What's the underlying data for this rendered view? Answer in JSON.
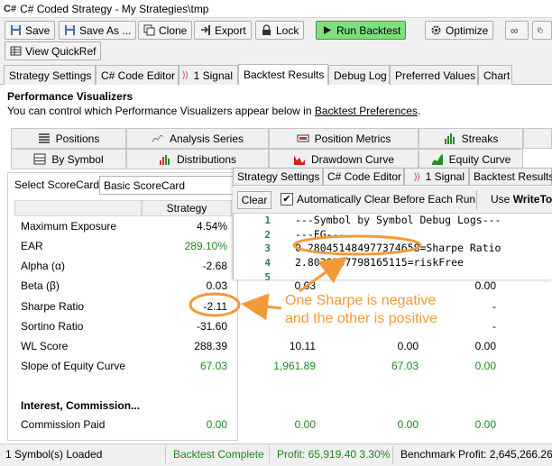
{
  "window": {
    "app_icon": "C#",
    "title": "C# Coded Strategy - My Strategies\\tmp"
  },
  "toolbar": {
    "save": "Save",
    "save_as": "Save As ...",
    "clone": "Clone",
    "export": "Export",
    "lock": "Lock",
    "run_backtest": "Run Backtest",
    "optimize": "Optimize",
    "view_quickref": "View QuickRef"
  },
  "main_tabs": [
    "Strategy Settings",
    "C# Code Editor",
    "1 Signal",
    "Backtest Results",
    "Debug Log",
    "Preferred Values",
    "Chart"
  ],
  "performance": {
    "title": "Performance Visualizers",
    "desc_prefix": "You can control which Performance Visualizers appear below in ",
    "desc_link": "Backtest Preferences",
    "desc_suffix": "."
  },
  "visualizer_tabs": {
    "row1": [
      "Positions",
      "Analysis Series",
      "Position Metrics",
      "Streaks"
    ],
    "row2": [
      "By Symbol",
      "Distributions",
      "Drawdown Curve",
      "Equity Curve"
    ]
  },
  "scorecard": {
    "label": "Select ScoreCard:",
    "selected": "Basic ScoreCard"
  },
  "grid": {
    "column": "Strategy",
    "rows": [
      {
        "label": "Maximum Exposure",
        "value": "4.54%",
        "color": "#000000"
      },
      {
        "label": "EAR",
        "value": "289.10%",
        "color": "#1a8a1a"
      },
      {
        "label": "Alpha (α)",
        "value": "-2.68",
        "color": "#000000"
      },
      {
        "label": "Beta (β)",
        "value": "0.03",
        "color": "#000000"
      },
      {
        "label": "Sharpe Ratio",
        "value": "-2.11",
        "color": "#000000"
      },
      {
        "label": "Sortino Ratio",
        "value": "-31.60",
        "color": "#000000"
      },
      {
        "label": "WL Score",
        "value": "288.39",
        "color": "#000000"
      },
      {
        "label": "Slope of Equity Curve",
        "value": "67.03",
        "color": "#1a8a1a"
      }
    ],
    "section2_title": "Interest, Commission...",
    "commission_label": "Commission Paid",
    "commission_value": "0.00"
  },
  "other_columns": {
    "beta": [
      "0.03",
      "0.00"
    ],
    "sharpe": [
      "-",
      "0.00"
    ],
    "sortino": [
      "-"
    ],
    "wl_score": [
      "10.11",
      "0.00",
      "0.00"
    ],
    "slope": [
      "1,961.89",
      "67.03",
      "0.00"
    ],
    "commission": [
      "0.00",
      "0.00",
      "0.00"
    ]
  },
  "debug": {
    "tabs": [
      "Strategy Settings",
      "C# Code Editor",
      "1 Signal",
      "Backtest Results"
    ],
    "clear": "Clear",
    "auto_clear": "Automatically Clear Before Each Run",
    "use_prefix": "Use ",
    "use_bold": "WriteTo",
    "lines": [
      {
        "n": "1",
        "text": "---Symbol by Symbol Debug Logs---"
      },
      {
        "n": "2",
        "text": "---FG---"
      },
      {
        "n": "3",
        "text": "0.280451484977374658=Sharpe Ratio"
      },
      {
        "n": "4",
        "text": "2.8029357798165115=riskFree"
      },
      {
        "n": "5",
        "text": ""
      }
    ]
  },
  "annotation": {
    "line1": "One Sharpe is negative",
    "line2": "and the other is positive",
    "color": "#f29a3a"
  },
  "status": {
    "symbols": "1 Symbol(s) Loaded",
    "complete": "Backtest Complete",
    "profit": "Profit: 65,919.40 3.30%",
    "benchmark": "Benchmark Profit: 2,645,266.26"
  }
}
